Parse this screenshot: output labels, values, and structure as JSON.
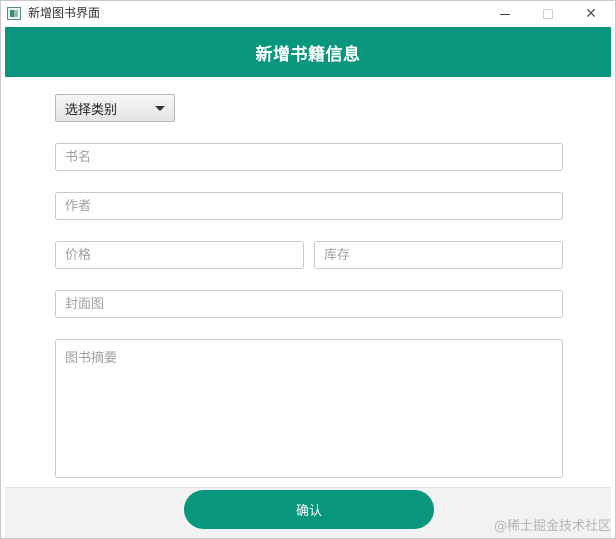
{
  "window": {
    "title": "新增图书界面",
    "minimize_glyph": "—",
    "close_glyph": "✕"
  },
  "header": {
    "title": "新增书籍信息"
  },
  "form": {
    "category_select": {
      "selected": "选择类别"
    },
    "book_name": {
      "placeholder": "书名",
      "value": ""
    },
    "author": {
      "placeholder": "作者",
      "value": ""
    },
    "price": {
      "placeholder": "价格",
      "value": ""
    },
    "stock": {
      "placeholder": "库存",
      "value": ""
    },
    "cover": {
      "placeholder": "封面图",
      "value": ""
    },
    "summary": {
      "placeholder": "图书摘要",
      "value": ""
    }
  },
  "footer": {
    "confirm_label": "确认"
  },
  "watermark": "@稀土掘金技术社区",
  "colors": {
    "accent": "#08967d",
    "footer_bg": "#f2f2f2",
    "placeholder": "#a0a0a0"
  },
  "icons": [
    "app-icon",
    "minimize-icon",
    "maximize-icon",
    "close-icon",
    "chevron-down-icon"
  ]
}
